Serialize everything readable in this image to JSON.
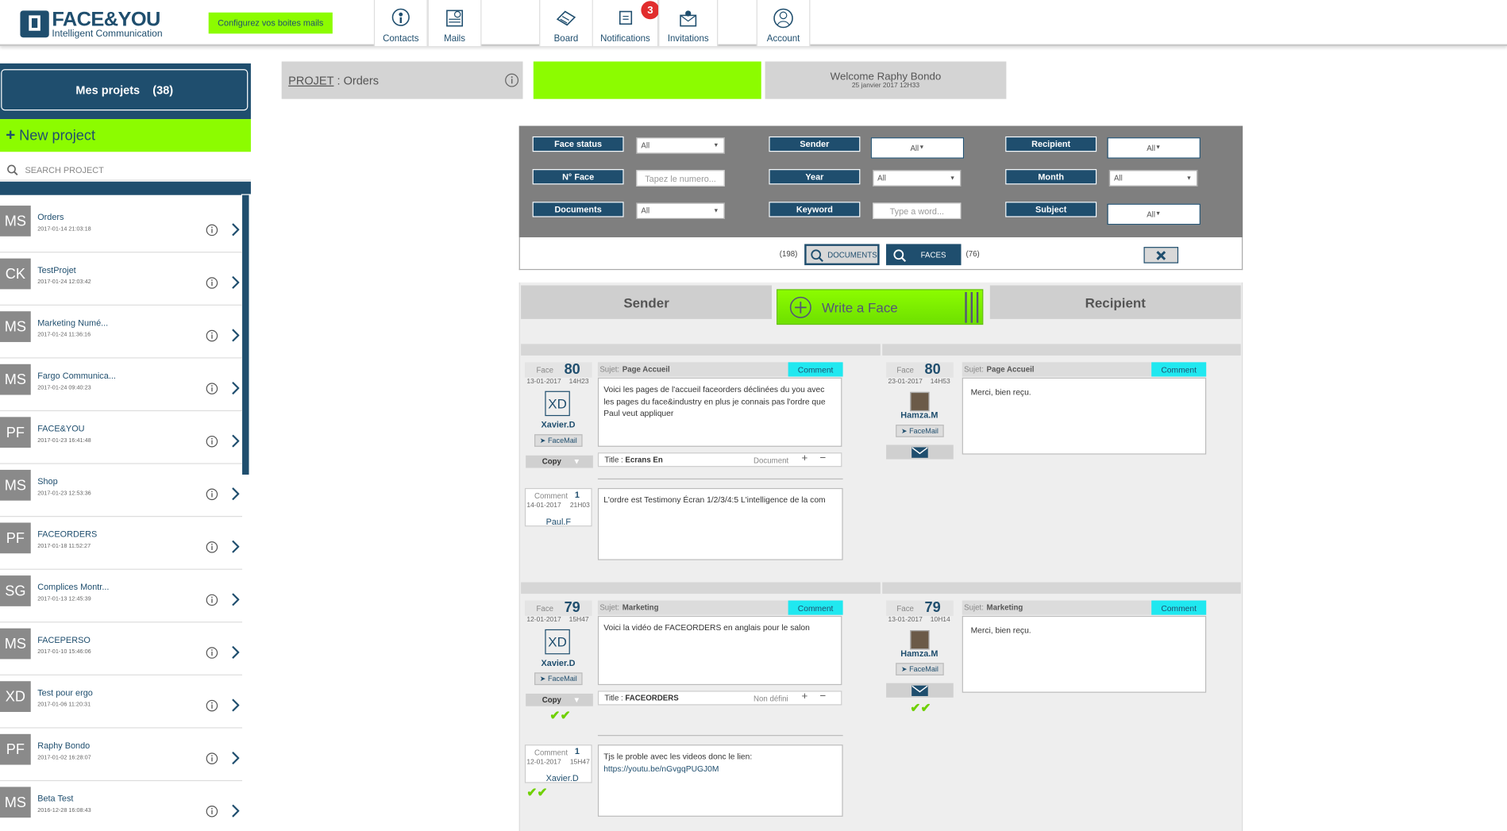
{
  "header": {
    "logo_text": "FACE&YOU",
    "logo_sub": "Intelligent Communication",
    "config_button": "Configurez vos boites mails",
    "nav": [
      {
        "label": "Contacts",
        "icon": "contacts-icon"
      },
      {
        "label": "Mails",
        "icon": "mails-icon"
      },
      {
        "label": "Board",
        "icon": "board-icon"
      },
      {
        "label": "Notifications",
        "icon": "notifications-icon",
        "badge": "3"
      },
      {
        "label": "Invitations",
        "icon": "invitations-icon"
      },
      {
        "label": "Account",
        "icon": "account-icon"
      }
    ]
  },
  "sidebar": {
    "title": "Mes projets",
    "count": "(38)",
    "new_project": "New project",
    "search_placeholder": "SEARCH PROJECT",
    "projects": [
      {
        "initials": "MS",
        "name": "Orders",
        "date": "2017-01-14 21:03:18"
      },
      {
        "initials": "CK",
        "name": "TestProjet",
        "date": "2017-01-24 12:03:42"
      },
      {
        "initials": "MS",
        "name": "Marketing Numé...",
        "date": "2017-01-24 11:36:16"
      },
      {
        "initials": "MS",
        "name": "Fargo Communica...",
        "date": "2017-01-24 09:40:23"
      },
      {
        "initials": "PF",
        "name": "FACE&YOU",
        "date": "2017-01-23 16:41:48"
      },
      {
        "initials": "MS",
        "name": "Shop",
        "date": "2017-01-23 12:53:36"
      },
      {
        "initials": "PF",
        "name": "FACEORDERS",
        "date": "2017-01-18 11:52:27"
      },
      {
        "initials": "SG",
        "name": "Complices Montr...",
        "date": "2017-01-13 12:45:39"
      },
      {
        "initials": "MS",
        "name": "FACEPERSO",
        "date": "2017-01-10 15:46:06"
      },
      {
        "initials": "XD",
        "name": "Test pour ergo",
        "date": "2017-01-06 11:20:31"
      },
      {
        "initials": "PF",
        "name": "Raphy Bondo",
        "date": "2017-01-02 16:28:07"
      },
      {
        "initials": "MS",
        "name": "Beta Test",
        "date": "2016-12-28 16:08:43"
      }
    ]
  },
  "breadcrumb": {
    "link": "PROJET",
    "sep": " : ",
    "current": "Orders"
  },
  "welcome": {
    "line1": "Welcome Raphy Bondo",
    "line2": "25 janvier 2017 12H33"
  },
  "filters": {
    "face_status": "Face status",
    "face_status_val": "All",
    "sender": "Sender",
    "sender_val": "All",
    "recipient": "Recipient",
    "recipient_val": "All",
    "n_face": "N° Face",
    "n_face_ph": "Tapez le numero...",
    "year": "Year",
    "year_val": "All",
    "month": "Month",
    "month_val": "All",
    "documents": "Documents",
    "documents_val": "All",
    "keyword": "Keyword",
    "keyword_ph": "Type a word...",
    "subject": "Subject",
    "subject_val": "All"
  },
  "search": {
    "doc_count": "(198)",
    "doc_label": "DOCUMENTS",
    "face_label": "FACES",
    "face_count": "(76)"
  },
  "columns": {
    "sender": "Sender",
    "write": "Write a Face",
    "recipient": "Recipient"
  },
  "faces": [
    {
      "sender": {
        "label": "Face",
        "num": "80",
        "date": "13-01-2017",
        "time": "14H23",
        "initials": "XD",
        "name": "Xavier.D",
        "facemail": "FaceMail",
        "copy": "Copy",
        "subject_prefix": "Sujet:",
        "subject": "Page Accueil",
        "comment": "Comment",
        "body": "Voici les pages de l'accueil faceorders déclinées du you avec les pages du face&industry en plus je connais pas l'ordre que Paul veut appliquer",
        "title_prefix": "Title :",
        "title": "Ecrans En",
        "doc": "Document"
      },
      "sender_comment": {
        "label": "Comment",
        "num": "1",
        "date": "14-01-2017",
        "time": "21H03",
        "name": "Paul.F",
        "body": "L'ordre est Testimony Écran 1/2/3/4:5 L'intelligence de la com"
      },
      "recipient": {
        "label": "Face",
        "num": "80",
        "date": "23-01-2017",
        "time": "14H53",
        "name": "Hamza.M",
        "facemail": "FaceMail",
        "subject_prefix": "Sujet:",
        "subject": "Page Accueil",
        "comment": "Comment",
        "body": "Merci, bien reçu."
      }
    },
    {
      "sender": {
        "label": "Face",
        "num": "79",
        "date": "12-01-2017",
        "time": "15H47",
        "initials": "XD",
        "name": "Xavier.D",
        "facemail": "FaceMail",
        "copy": "Copy",
        "subject_prefix": "Sujet:",
        "subject": "Marketing",
        "comment": "Comment",
        "body": "Voici la vidéo de FACEORDERS en anglais pour le salon",
        "title_prefix": "Title :",
        "title": "FACEORDERS",
        "doc": "Non défini"
      },
      "sender_comment": {
        "label": "Comment",
        "num": "1",
        "date": "12-01-2017",
        "time": "15H47",
        "name": "Xavier.D",
        "body": "Tjs le proble avec les videos donc le lien:",
        "link": "https://youtu.be/nGvgqPUGJ0M"
      },
      "recipient": {
        "label": "Face",
        "num": "79",
        "date": "13-01-2017",
        "time": "10H14",
        "name": "Hamza.M",
        "facemail": "FaceMail",
        "subject_prefix": "Sujet:",
        "subject": "Marketing",
        "comment": "Comment",
        "body": "Merci, bien reçu."
      }
    }
  ]
}
